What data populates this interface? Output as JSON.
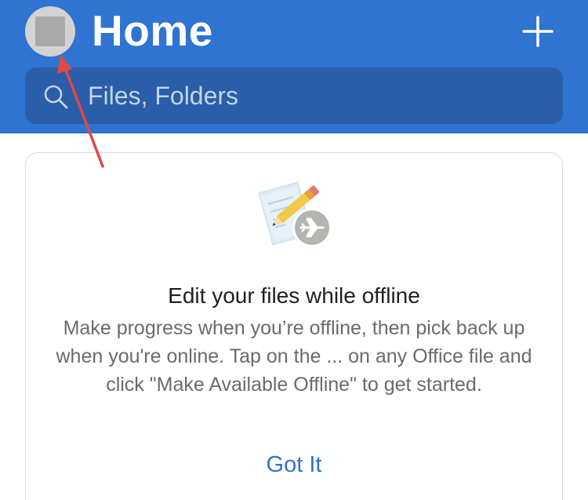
{
  "header": {
    "title": "Home",
    "add_icon": "plus-icon",
    "avatar_icon": "profile-avatar",
    "background_color": "#2f74d0"
  },
  "search": {
    "placeholder": "Files, Folders",
    "icon": "search-icon"
  },
  "offline_card": {
    "illustration": "document-pencil-airplane-icon",
    "title": "Edit your files while offline",
    "body": "Make progress when you’re offline, then pick back up when you're online. Tap on the ... on any Office file and click \"Make Available Offline\" to get started.",
    "action_label": "Got It",
    "action_color": "#2f74d0"
  },
  "annotation": {
    "arrow_color": "#e04848",
    "points_to": "avatar"
  }
}
